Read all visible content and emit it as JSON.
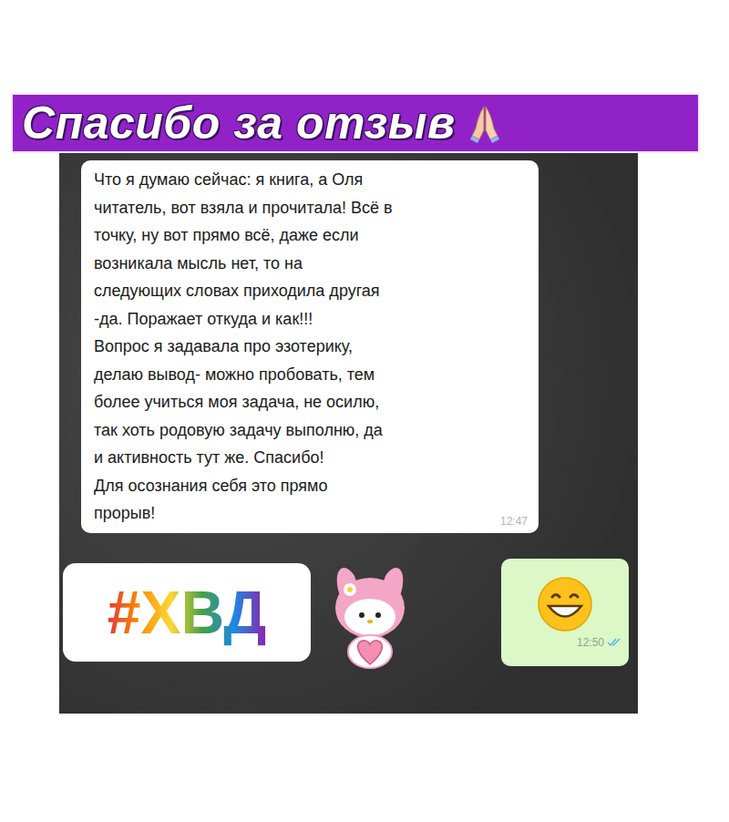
{
  "banner": {
    "title": "Спасибо за отзыв"
  },
  "message": {
    "lines": [
      "Что я думаю сейчас: я книга, а Оля",
      "читатель, вот взяла и прочитала! Всё в",
      "точку, ну вот прямо всё, даже если",
      "возникала мысль нет, то на",
      "следующих словах приходила другая",
      "-да. Поражает откуда и как!!!",
      "Вопрос я задавала про эзотерику,",
      "делаю вывод- можно пробовать, тем",
      "более учиться моя задача, не осилю,",
      "так хоть родовую задачу выполню, да",
      "и активность тут же. Спасибо!",
      "Для осознания себя это прямо",
      "прорыв!"
    ],
    "time": "12:47"
  },
  "sticker": {
    "text": "#ХВД"
  },
  "reply": {
    "time": "12:50",
    "read": true
  }
}
